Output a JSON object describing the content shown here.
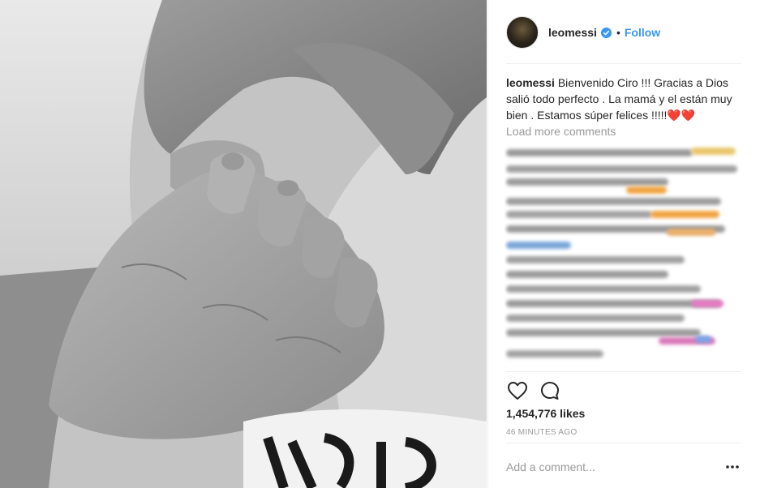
{
  "post": {
    "image_alt": "Black and white photo of a baby's hand holding an adult finger"
  },
  "header": {
    "username": "leomessi",
    "separator": "•",
    "follow_label": "Follow"
  },
  "caption": {
    "username": "leomessi",
    "text": "Bienvenido Ciro !!! Gracias a Dios salió todo perfecto . La mamá y el están muy bien . Estamos súper felices !!!!!❤️❤️"
  },
  "comments": {
    "load_more_label": "Load more comments"
  },
  "actions": {
    "like_icon": "heart-icon",
    "comment_icon": "comment-icon"
  },
  "stats": {
    "likes": "1,454,776 likes",
    "timestamp": "46 MINUTES AGO"
  },
  "comment_box": {
    "placeholder": "Add a comment...",
    "more_icon": "more-options-icon"
  },
  "colors": {
    "link_blue": "#3897f0",
    "verified_blue": "#3897f0",
    "text_primary": "#262626",
    "text_secondary": "#999999",
    "divider": "#efefef"
  }
}
